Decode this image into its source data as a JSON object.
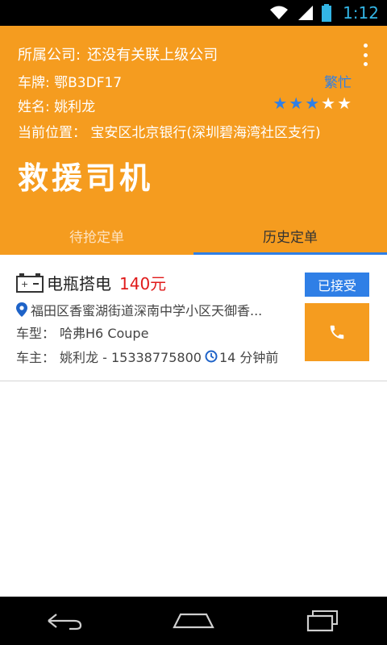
{
  "status_bar": {
    "time": "1:12",
    "icons": [
      "wifi-icon",
      "signal-icon",
      "battery-icon"
    ]
  },
  "header": {
    "company_label": "所属公司:",
    "company_value": "还没有关联上级公司",
    "plate_label": "车牌:",
    "plate_value": "鄂B3DF17",
    "name_label": "姓名:",
    "name_value": "姚利龙",
    "location_label": "当前位置：",
    "location_value": "宝安区北京银行(深圳碧海湾社区支行)",
    "status": "繁忙",
    "rating": 3,
    "rating_max": 5,
    "title": "救援司机",
    "colors": {
      "primary": "#f59c1f",
      "accent": "#2f7fe6"
    }
  },
  "tabs": [
    {
      "label": "待抢定单",
      "active": false
    },
    {
      "label": "历史定单",
      "active": true
    }
  ],
  "orders": [
    {
      "service": "电瓶搭电",
      "price": "140元",
      "address": "福田区香蜜湖街道深南中学小区天御香...",
      "car_label": "车型：",
      "car_value": "哈弗H6 Coupe",
      "owner_label": "车主：",
      "owner_value": "姚利龙 - 15338775800",
      "time_ago": "14 分钟前",
      "status_button": "已接受",
      "call_icon": "phone-icon"
    }
  ],
  "nav_bar": {
    "icons": [
      "back-icon",
      "home-icon",
      "recent-apps-icon"
    ]
  }
}
